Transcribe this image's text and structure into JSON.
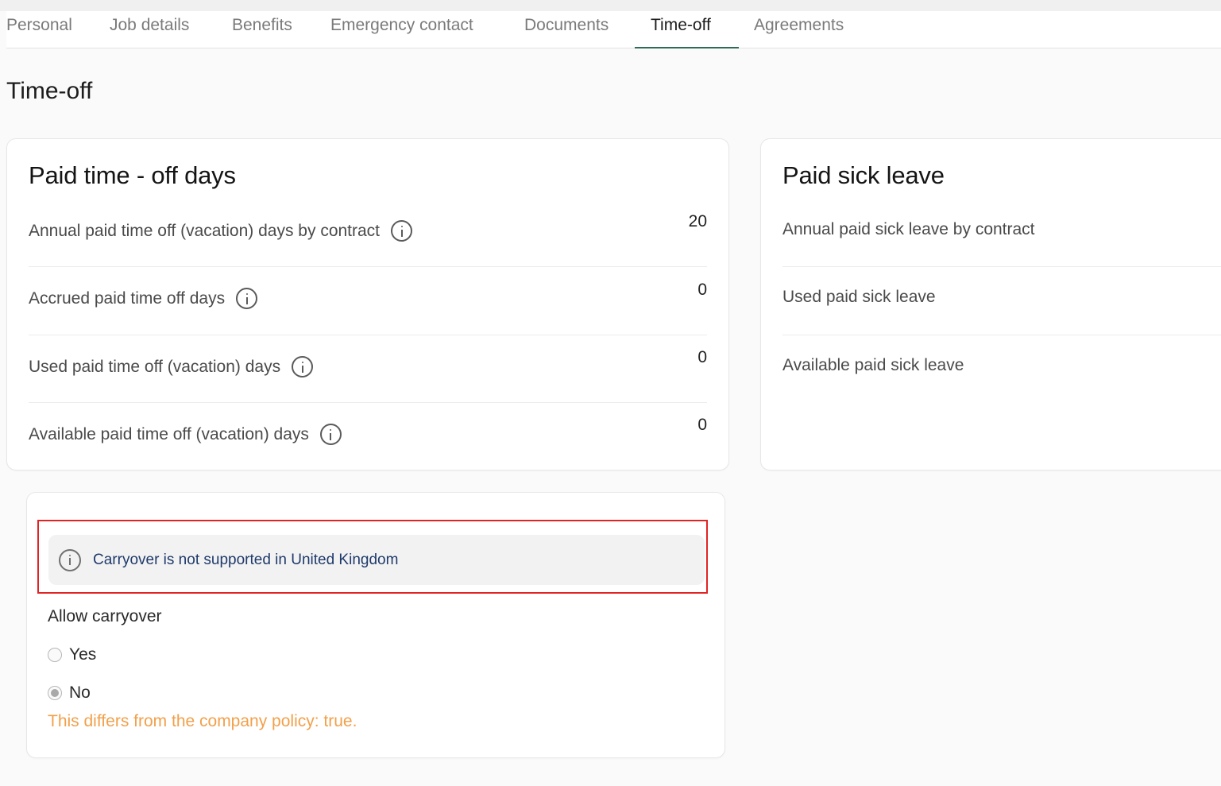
{
  "tabs": [
    {
      "label": "Personal"
    },
    {
      "label": "Job details"
    },
    {
      "label": "Benefits"
    },
    {
      "label": "Emergency contact"
    },
    {
      "label": "Documents"
    },
    {
      "label": "Time-off",
      "active": true
    },
    {
      "label": "Agreements"
    }
  ],
  "page_title": "Time-off",
  "pto_card": {
    "title": "Paid time - off days",
    "rows": [
      {
        "label": "Annual paid time off (vacation) days by contract",
        "value": "20"
      },
      {
        "label": "Accrued paid time off days",
        "value": "0"
      },
      {
        "label": "Used paid time off (vacation) days",
        "value": "0"
      },
      {
        "label": "Available paid time off (vacation) days",
        "value": "0"
      }
    ]
  },
  "sick_card": {
    "title": "Paid sick leave",
    "rows": [
      {
        "label": "Annual paid sick leave by contract"
      },
      {
        "label": "Used paid sick leave"
      },
      {
        "label": "Available paid sick leave"
      }
    ]
  },
  "carryover": {
    "notice": "Carryover is not supported in United Kingdom",
    "allow_label": "Allow carryover",
    "options": [
      {
        "label": "Yes",
        "checked": false
      },
      {
        "label": "No",
        "checked": true
      }
    ],
    "policy_warning": "This differs from the company policy: true."
  },
  "colors": {
    "accent_underline": "#2d6b57",
    "highlight_border": "#e02424",
    "notice_text": "#1f3a6b",
    "warning_text": "#f2a04a"
  }
}
